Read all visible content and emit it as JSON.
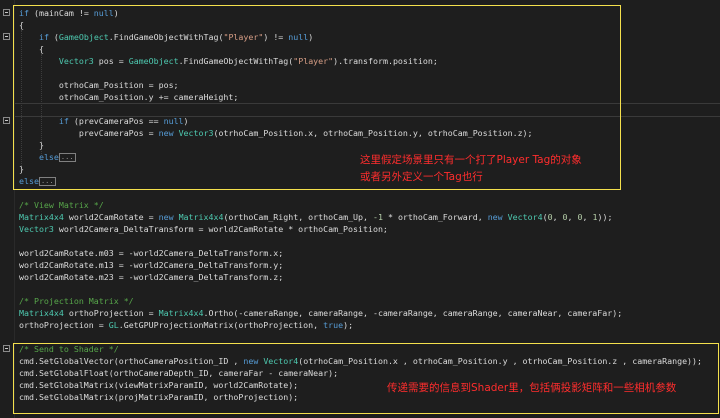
{
  "code": {
    "l1": {
      "a": "if (mainCam != ",
      "b": "null",
      "c": ")"
    },
    "l2": "{",
    "l3": {
      "a": "if (",
      "b": "GameObject",
      "c": ".FindGameObjectWithTag(",
      "d": "\"Player\"",
      "e": ") != ",
      "f": "null",
      "g": ")"
    },
    "l4": "{",
    "l5": {
      "a": "Vector3",
      "b": " pos = ",
      "c": "GameObject",
      "d": ".FindGameObjectWithTag(",
      "e": "\"Player\"",
      "f": ").transform.position;"
    },
    "l6": "otrhoCam_Position = pos;",
    "l7": "otrhoCam_Position.y += cameraHeight;",
    "l8": {
      "a": "if (prevCameraPos == ",
      "b": "null",
      "c": ")"
    },
    "l9": {
      "a": "prevCameraPos = ",
      "b": "new",
      "c": " ",
      "d": "Vector3",
      "e": "(otrhoCam_Position.x, otrhoCam_Position.y, otrhoCam_Position.z);"
    },
    "l10": "}",
    "l11": "else",
    "l12": "}",
    "l13": "else",
    "l14": "/* View Matrix */",
    "l15": {
      "a": "Matrix4x4",
      "b": " world2CamRotate = ",
      "c": "new",
      "d": " ",
      "e": "Matrix4x4",
      "f": "(orthoCam_Right, orthoCam_Up, ",
      "g": "-1",
      "h": " * orthoCam_Forward, ",
      "i": "new",
      "j": " ",
      "k": "Vector4",
      "l": "(",
      "m": "0",
      "n": ", ",
      "o": "0",
      "p": ", ",
      "q": "0",
      "r": ", ",
      "s": "1",
      "t": "));"
    },
    "l16": {
      "a": "Vector3",
      "b": " world2Camera_DeltaTransform = world2CamRotate * orthoCam_Position;"
    },
    "l17": "world2CamRotate.m03 = -world2Camera_DeltaTransform.x;",
    "l18": "world2CamRotate.m13 = -world2Camera_DeltaTransform.y;",
    "l19": "world2CamRotate.m23 = -world2Camera_DeltaTransform.z;",
    "l20": "/* Projection Matrix */",
    "l21": {
      "a": "Matrix4x4",
      "b": " orthoProjection = ",
      "c": "Matrix4x4",
      "d": ".Ortho(-cameraRange, cameraRange, -cameraRange, cameraRange, cameraNear, cameraFar);"
    },
    "l22": {
      "a": "orthoProjection = ",
      "b": "GL",
      "c": ".GetGPUProjectionMatrix(orthoProjection, ",
      "d": "true",
      "e": ");"
    },
    "l23": "/* Send to Shader */",
    "l24": {
      "a": "cmd.SetGlobalVector(orthoCameraPosition_ID , ",
      "b": "new",
      "c": " ",
      "d": "Vector4",
      "e": "(otrhoCam_Position.x , otrhoCam_Position.y , otrhoCam_Position.z , cameraRange));"
    },
    "l25": "cmd.SetGlobalFloat(orthoCameraDepth_ID, cameraFar - cameraNear);",
    "l26": "cmd.SetGlobalMatrix(viewMatrixParamID, world2CamRotate);",
    "l27": "cmd.SetGlobalMatrix(projMatrixParamID, orthoProjection);",
    "collapsed_marker": "..."
  },
  "annotations": {
    "note1": "这里假定场景里只有一个打了Player Tag的对象\n或者另外定义一个Tag也行",
    "note2": "传递需要的信息到Shader里，包括俩投影矩阵和一些相机参数"
  },
  "colors": {
    "keyword": "#569cd6",
    "type": "#4ec9b0",
    "string": "#d69d85",
    "comment": "#57a64a",
    "number": "#b5cea8",
    "highlight_box": "#f4e04d",
    "annotation": "#ff2d2d"
  }
}
